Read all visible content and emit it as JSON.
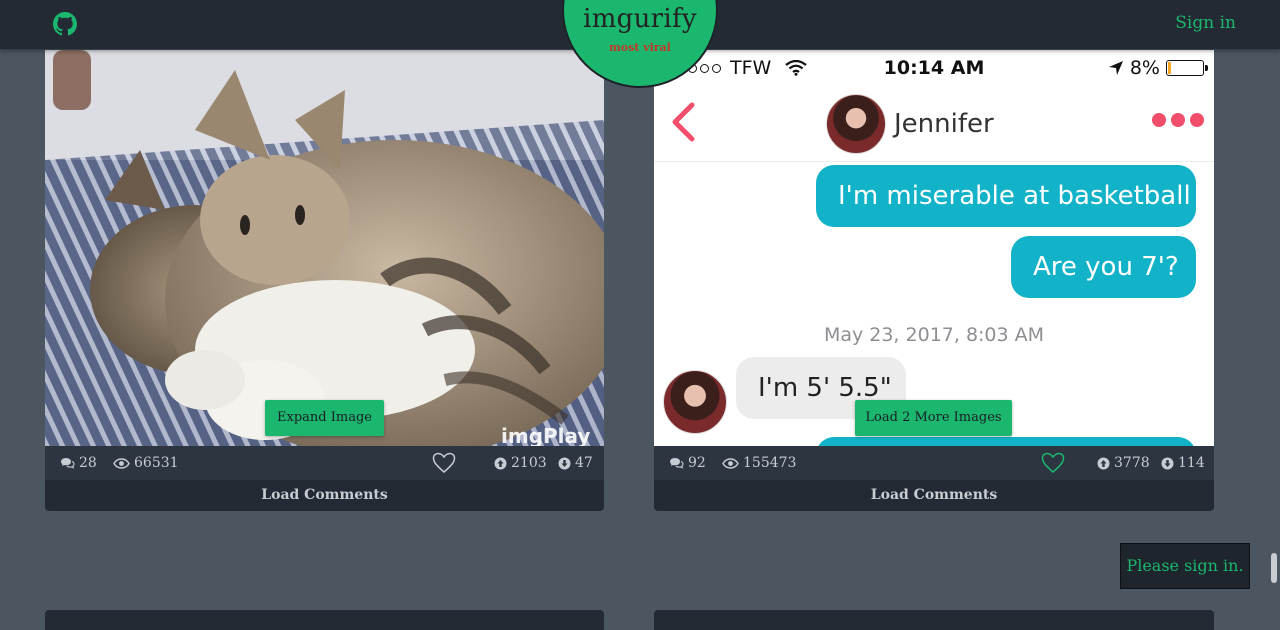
{
  "header": {
    "logo_title": "imgurify",
    "logo_subtitle": "most viral",
    "sign_in_label": "Sign in",
    "github_icon": "github-icon"
  },
  "posts": [
    {
      "media": "kittens-cuddling-gif",
      "watermark": "imgPlay",
      "expand_label": "Expand Image",
      "comments": "28",
      "views": "66531",
      "upvotes": "2103",
      "downvotes": "47",
      "liked": false,
      "load_comments_label": "Load Comments"
    },
    {
      "media": "phone-chat-screenshot",
      "load_more_label": "Load 2 More Images",
      "comments": "92",
      "views": "155473",
      "upvotes": "3778",
      "downvotes": "114",
      "liked": true,
      "load_comments_label": "Load Comments",
      "phone": {
        "carrier": "TFW",
        "time": "10:14 AM",
        "battery": "8%",
        "contact_name": "Jennifer",
        "messages": [
          {
            "from": "me",
            "text": "I'm miserable at basketball"
          },
          {
            "from": "me",
            "text": "Are you 7'?"
          },
          {
            "from": "them",
            "text": "I'm 5' 5.5\""
          }
        ],
        "timestamp": "May 23, 2017, 8:03 AM"
      }
    }
  ],
  "toast": {
    "text": "Please sign in."
  },
  "colors": {
    "accent": "#1bb76e",
    "background": "#4b5661",
    "topbar": "#232a33",
    "bubble_out": "#12b2c8",
    "liked_heart": "#1bb76e"
  }
}
